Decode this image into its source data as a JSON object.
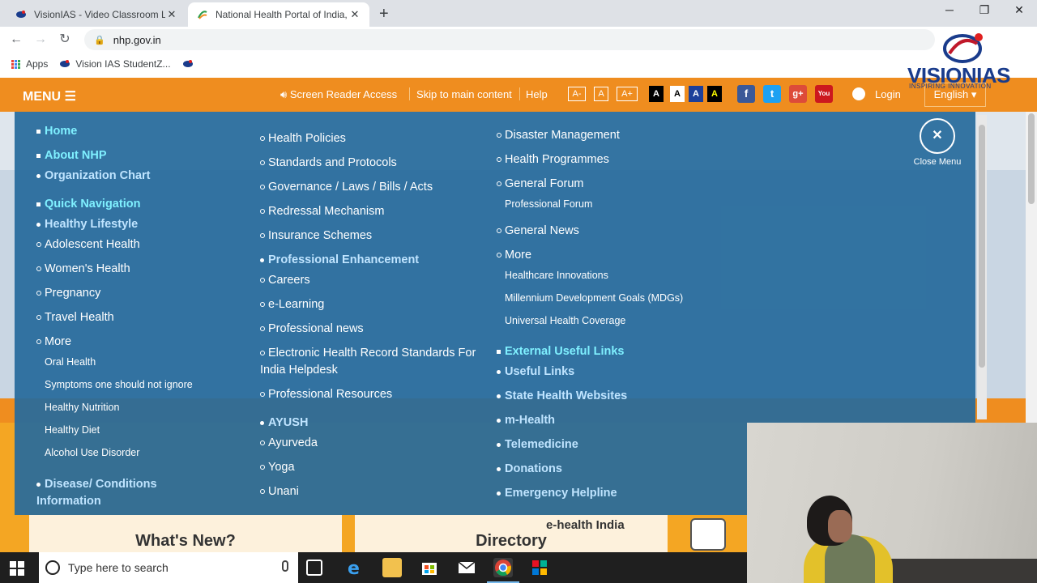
{
  "browser": {
    "tabs": [
      {
        "title": "VisionIAS - Video Classroom Lec",
        "active": false
      },
      {
        "title": "National Health Portal of India, G",
        "active": true
      }
    ],
    "url": "nhp.gov.in",
    "bookmarks": [
      {
        "label": "Apps"
      },
      {
        "label": "Vision IAS StudentZ..."
      }
    ]
  },
  "watermark": {
    "name": "VISIONIAS",
    "tagline": "INSPIRING INNOVATION"
  },
  "site_bar": {
    "menu_label": "MENU",
    "screen_reader": "Screen Reader Access",
    "skip": "Skip to main content",
    "help": "Help",
    "font_sizes": [
      "A-",
      "A",
      "A+"
    ],
    "contrast": [
      "A",
      "A",
      "A",
      "A"
    ],
    "social": [
      "f",
      "t",
      "g+",
      "You"
    ],
    "login": "Login",
    "language": "English"
  },
  "menu": {
    "col1": {
      "home": "Home",
      "about": "About NHP",
      "org_chart": "Organization Chart",
      "quick_nav": "Quick Navigation",
      "healthy_lifestyle": "Healthy Lifestyle",
      "items": [
        "Adolescent Health",
        "Women's Health",
        "Pregnancy",
        "Travel Health",
        "More"
      ],
      "more_items": [
        "Oral Health",
        "Symptoms one should not ignore",
        "Healthy Nutrition",
        "Healthy Diet",
        "Alcohol Use Disorder"
      ],
      "disease_line1": "Disease/ Conditions",
      "disease_line2": "Information"
    },
    "col2": {
      "items": [
        "Health Policies",
        "Standards and Protocols",
        "Governance / Laws / Bills / Acts",
        "Redressal Mechanism",
        "Insurance Schemes"
      ],
      "prof_enh": "Professional Enhancement",
      "prof_items": [
        "Careers",
        "e-Learning",
        "Professional news"
      ],
      "ehr_line1": "Electronic Health Record Standards For",
      "ehr_line2": "India Helpdesk",
      "prof_resources": "Professional Resources",
      "ayush": "AYUSH",
      "ayush_items": [
        "Ayurveda",
        "Yoga",
        "Unani"
      ]
    },
    "col3": {
      "items": [
        "Disaster Management",
        "Health Programmes",
        "General Forum"
      ],
      "professional_forum": "Professional Forum",
      "general_news": "General News",
      "more": "More",
      "more_items": [
        "Healthcare Innovations",
        "Millennium Development Goals (MDGs)",
        "Universal Health Coverage"
      ],
      "external": "External Useful Links",
      "links": [
        "Useful Links",
        "State Health Websites",
        "m-Health",
        "Telemedicine",
        "Donations",
        "Emergency Helpline"
      ]
    },
    "close_label": "Close Menu"
  },
  "page": {
    "whats_new": "What's New?",
    "directory": "Directory",
    "ehealth": "e-health India"
  },
  "taskbar": {
    "search_placeholder": "Type here to search"
  },
  "colors": {
    "accent_orange": "#ef8d1f",
    "menu_blue": "#276b9c",
    "highlight_cyan": "#7ff0ff"
  }
}
